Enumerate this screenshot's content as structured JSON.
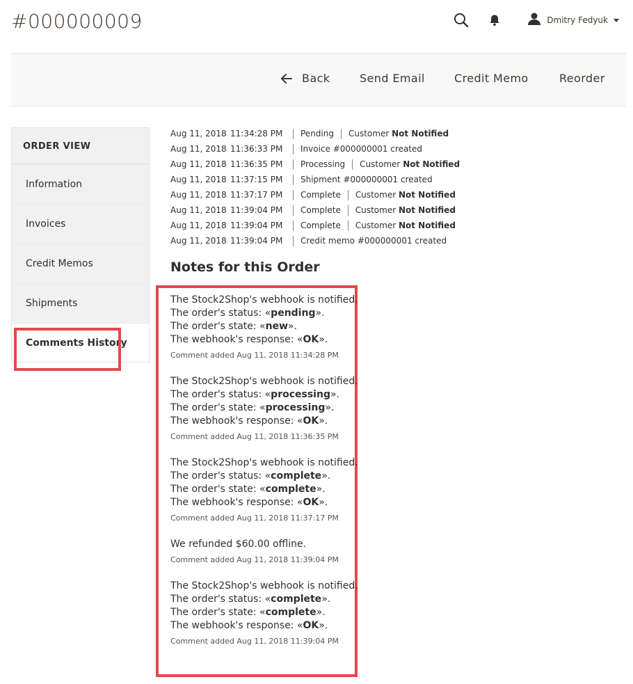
{
  "page": {
    "title": "#000000009"
  },
  "header": {
    "user_name": "Dmitry Fedyuk",
    "search_icon": "search-icon",
    "bell_icon": "bell-icon",
    "user_icon": "user-icon"
  },
  "actions": {
    "back": "Back",
    "send_email": "Send Email",
    "credit_memo": "Credit Memo",
    "reorder": "Reorder"
  },
  "sidebar": {
    "title": "ORDER VIEW",
    "items": [
      "Information",
      "Invoices",
      "Credit Memos",
      "Shipments",
      "Comments History"
    ],
    "active": "Comments History"
  },
  "history": [
    {
      "date": "Aug 11, 2018",
      "time": "11:34:28 PM",
      "event": "Pending",
      "notif_prefix": "Customer",
      "notif_bold": "Not Notified"
    },
    {
      "date": "Aug 11, 2018",
      "time": "11:36:33 PM",
      "event": "Invoice #000000001 created",
      "notif_prefix": "",
      "notif_bold": ""
    },
    {
      "date": "Aug 11, 2018",
      "time": "11:36:35 PM",
      "event": "Processing",
      "notif_prefix": "Customer",
      "notif_bold": "Not Notified"
    },
    {
      "date": "Aug 11, 2018",
      "time": "11:37:15 PM",
      "event": "Shipment #000000001 created",
      "notif_prefix": "",
      "notif_bold": ""
    },
    {
      "date": "Aug 11, 2018",
      "time": "11:37:17 PM",
      "event": "Complete",
      "notif_prefix": "Customer",
      "notif_bold": "Not Notified"
    },
    {
      "date": "Aug 11, 2018",
      "time": "11:39:04 PM",
      "event": "Complete",
      "notif_prefix": "Customer",
      "notif_bold": "Not Notified"
    },
    {
      "date": "Aug 11, 2018",
      "time": "11:39:04 PM",
      "event": "Complete",
      "notif_prefix": "Customer",
      "notif_bold": "Not Notified"
    },
    {
      "date": "Aug 11, 2018",
      "time": "11:39:04 PM",
      "event": "Credit memo #000000001 created",
      "notif_prefix": "",
      "notif_bold": ""
    }
  ],
  "notes_title": "Notes for this Order",
  "notes": [
    {
      "lines": [
        [
          {
            "t": "The Stock2Shop's webhook is notified."
          }
        ],
        [
          {
            "t": "The order's status: «"
          },
          {
            "t": "pending",
            "b": true
          },
          {
            "t": "»."
          }
        ],
        [
          {
            "t": "The order's state: «"
          },
          {
            "t": "new",
            "b": true
          },
          {
            "t": "»."
          }
        ],
        [
          {
            "t": "The webhook's response: «"
          },
          {
            "t": "OK",
            "b": true
          },
          {
            "t": "»."
          }
        ]
      ],
      "meta": "Comment added Aug 11, 2018 11:34:28 PM"
    },
    {
      "lines": [
        [
          {
            "t": "The Stock2Shop's webhook is notified."
          }
        ],
        [
          {
            "t": "The order's status: «"
          },
          {
            "t": "processing",
            "b": true
          },
          {
            "t": "»."
          }
        ],
        [
          {
            "t": "The order's state: «"
          },
          {
            "t": "processing",
            "b": true
          },
          {
            "t": "»."
          }
        ],
        [
          {
            "t": "The webhook's response: «"
          },
          {
            "t": "OK",
            "b": true
          },
          {
            "t": "»."
          }
        ]
      ],
      "meta": "Comment added Aug 11, 2018 11:36:35 PM"
    },
    {
      "lines": [
        [
          {
            "t": "The Stock2Shop's webhook is notified."
          }
        ],
        [
          {
            "t": "The order's status: «"
          },
          {
            "t": "complete",
            "b": true
          },
          {
            "t": "»."
          }
        ],
        [
          {
            "t": "The order's state: «"
          },
          {
            "t": "complete",
            "b": true
          },
          {
            "t": "»."
          }
        ],
        [
          {
            "t": "The webhook's response: «"
          },
          {
            "t": "OK",
            "b": true
          },
          {
            "t": "»."
          }
        ]
      ],
      "meta": "Comment added Aug 11, 2018 11:37:17 PM"
    },
    {
      "lines": [
        [
          {
            "t": "We refunded $60.00 offline."
          }
        ]
      ],
      "meta": "Comment added Aug 11, 2018 11:39:04 PM"
    },
    {
      "lines": [
        [
          {
            "t": "The Stock2Shop's webhook is notified."
          }
        ],
        [
          {
            "t": "The order's status: «"
          },
          {
            "t": "complete",
            "b": true
          },
          {
            "t": "»."
          }
        ],
        [
          {
            "t": "The order's state: «"
          },
          {
            "t": "complete",
            "b": true
          },
          {
            "t": "»."
          }
        ],
        [
          {
            "t": "The webhook's response: «"
          },
          {
            "t": "OK",
            "b": true
          },
          {
            "t": "»."
          }
        ]
      ],
      "meta": "Comment added Aug 11, 2018 11:39:04 PM"
    }
  ],
  "colors": {
    "highlight": "#e04b4b",
    "text": "#303030",
    "panel_bg": "#f1f1f1"
  }
}
